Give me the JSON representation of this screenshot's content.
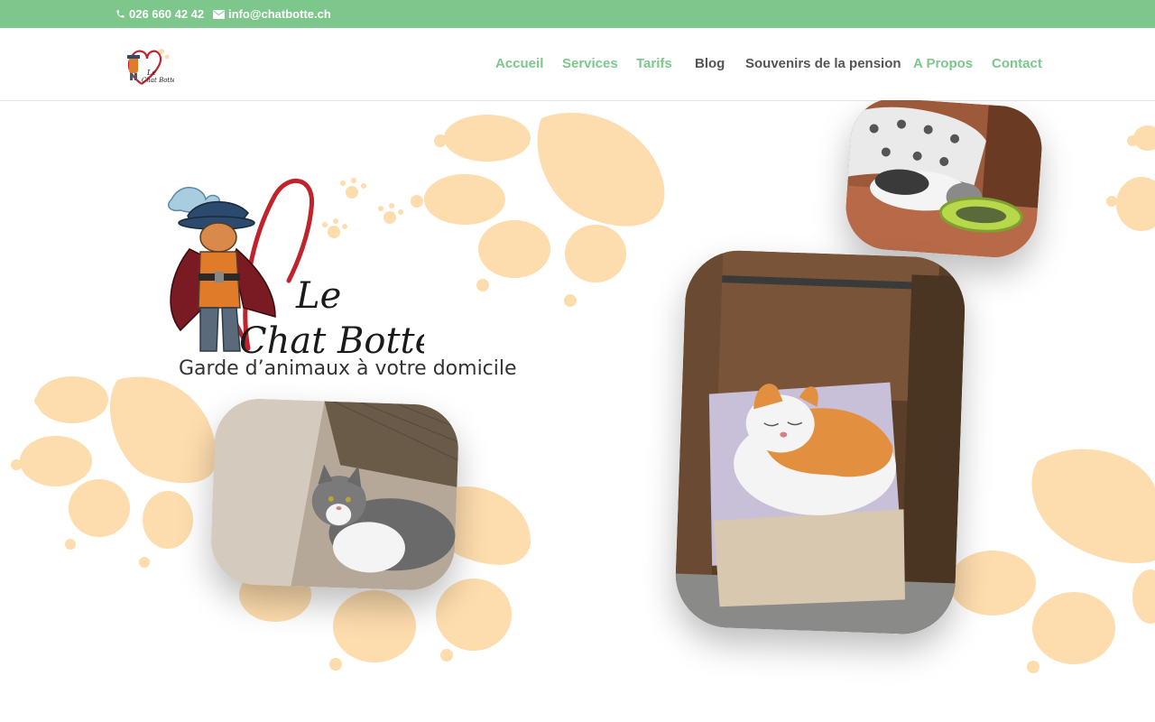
{
  "topbar": {
    "phone": "026 660 42 42",
    "email": "info@chatbotte.ch",
    "phone_icon": "phone-icon",
    "email_icon": "envelope-icon",
    "background_color": "#7dc78c"
  },
  "nav": {
    "items": [
      {
        "label": "Accueil",
        "color": "#7dc78c"
      },
      {
        "label": "Services",
        "color": "#7dc78c"
      },
      {
        "label": "Tarifs",
        "color": "#7dc78c"
      },
      {
        "label": "Blog",
        "color": "#555555"
      },
      {
        "label": "Souvenirs de la pension",
        "color": "#555555"
      },
      {
        "label": "A Propos",
        "color": "#7dc78c"
      },
      {
        "label": "Contact",
        "color": "#7dc78c"
      }
    ]
  },
  "brand": {
    "logo_line1": "Le",
    "logo_line2": "Chat Botté",
    "tagline": "Garde d’animaux à votre domicile"
  },
  "colors": {
    "paw": "#fddcad",
    "heart": "#c0232b",
    "accent_green": "#7dc78c"
  }
}
